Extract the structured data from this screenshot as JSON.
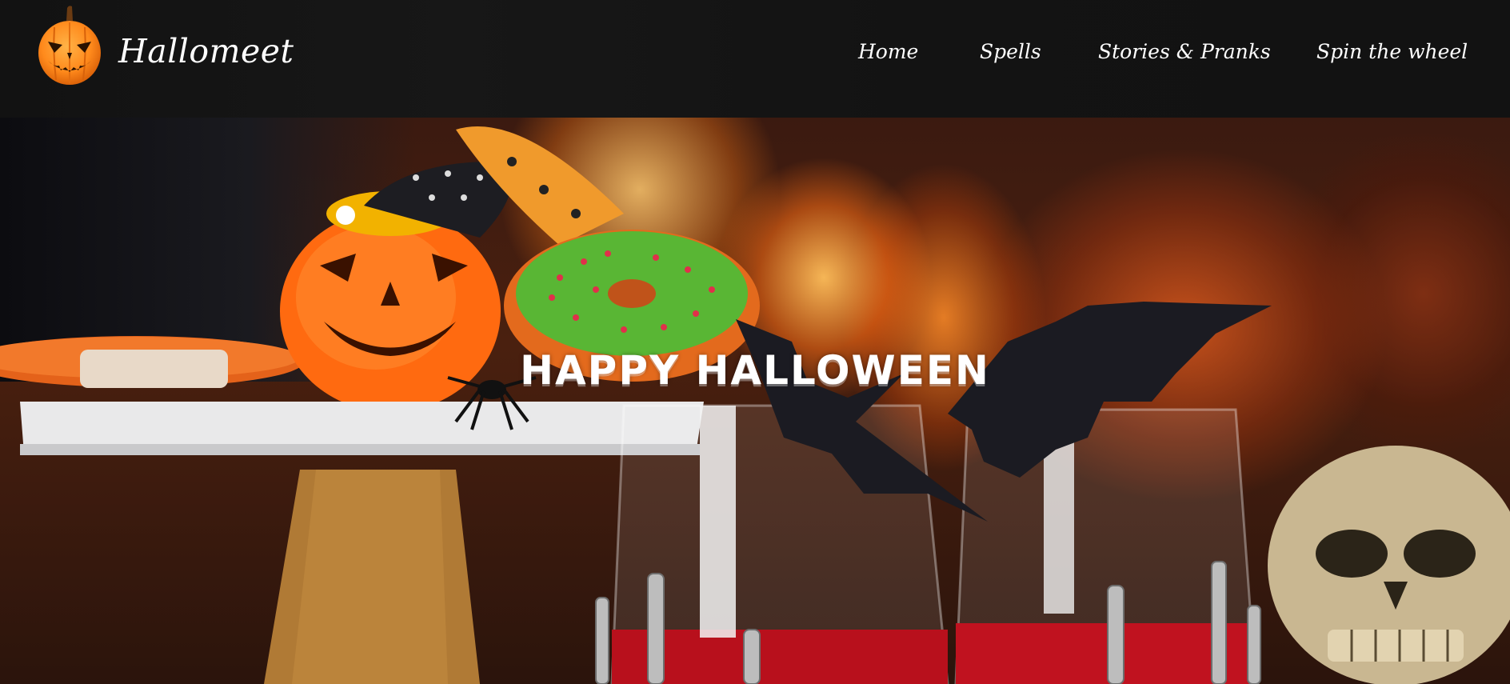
{
  "header": {
    "brand": "Hallomeet",
    "logo_icon": "jack-o-lantern-icon",
    "nav": [
      {
        "label": "Home"
      },
      {
        "label": "Spells"
      },
      {
        "label": "Stories & Pranks"
      },
      {
        "label": "Spin the wheel"
      }
    ]
  },
  "hero": {
    "title": "HAPPY HALLOWEEN",
    "background_icon": "halloween-party-photo"
  },
  "colors": {
    "header_bg": "#121212",
    "accent_orange": "#ff7a1a",
    "text": "#ffffff"
  }
}
